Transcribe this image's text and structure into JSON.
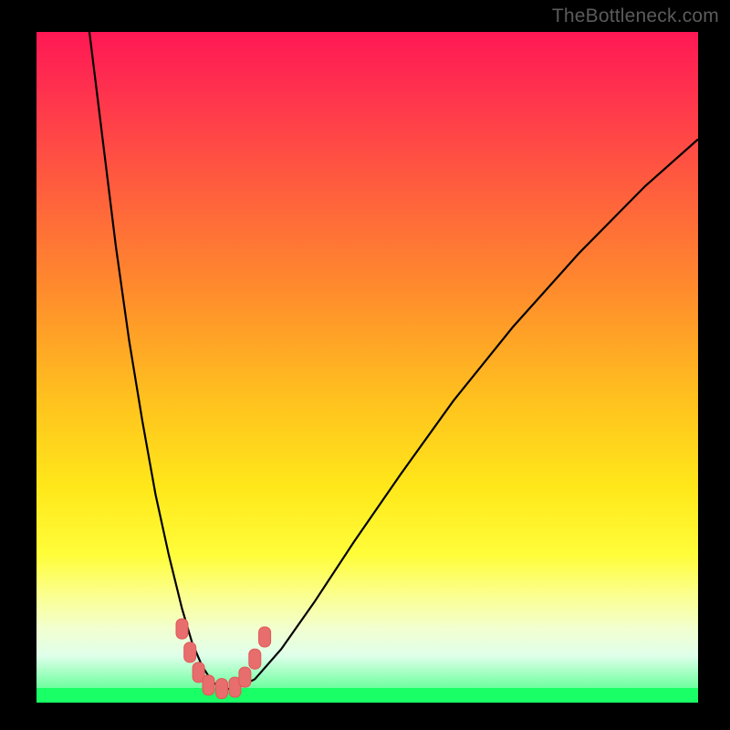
{
  "watermark": "TheBottleneck.com",
  "colors": {
    "page_bg": "#000000",
    "curve": "#000000",
    "marker": "#e86d6d",
    "green": "#19ff66"
  },
  "chart_data": {
    "type": "line",
    "title": "",
    "xlabel": "",
    "ylabel": "",
    "xlim": [
      0,
      100
    ],
    "ylim": [
      0,
      100
    ],
    "grid": false,
    "legend": false,
    "series": [
      {
        "name": "bottleneck-curve",
        "x": [
          8,
          10,
          12,
          14,
          16,
          18,
          20,
          22,
          23.5,
          25,
          26.5,
          28,
          30,
          33,
          37,
          42,
          48,
          55,
          63,
          72,
          82,
          92,
          100
        ],
        "y": [
          100,
          84,
          68,
          54,
          42,
          31,
          22,
          14,
          9,
          5.5,
          3.2,
          2.1,
          2.0,
          3.5,
          8,
          15,
          24,
          34,
          45,
          56,
          67,
          77,
          84
        ]
      }
    ],
    "markers": [
      {
        "x": 22.0,
        "y": 11.0
      },
      {
        "x": 23.2,
        "y": 7.5
      },
      {
        "x": 24.5,
        "y": 4.5
      },
      {
        "x": 26.0,
        "y": 2.6
      },
      {
        "x": 28.0,
        "y": 2.1
      },
      {
        "x": 30.0,
        "y": 2.3
      },
      {
        "x": 31.5,
        "y": 3.8
      },
      {
        "x": 33.0,
        "y": 6.5
      },
      {
        "x": 34.5,
        "y": 9.8
      }
    ],
    "annotations": []
  }
}
